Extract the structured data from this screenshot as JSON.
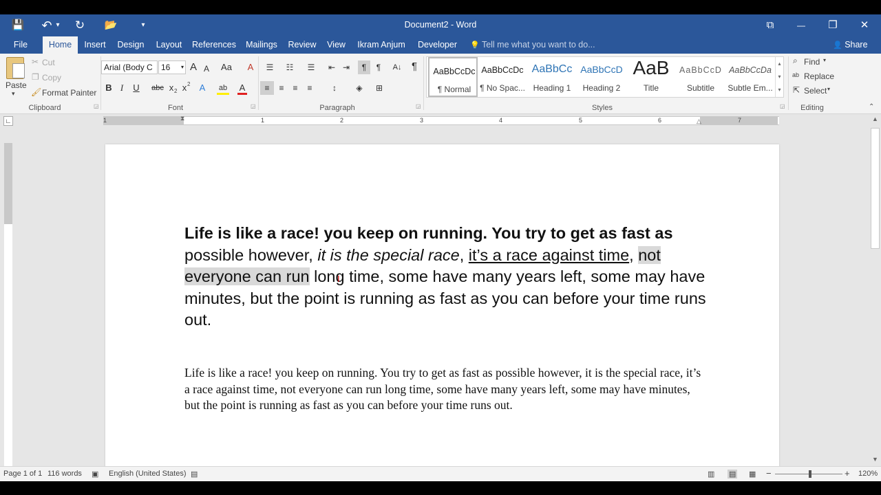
{
  "window": {
    "title": "Document2 - Word",
    "restore_icon": "⧉",
    "minimize_icon": "—",
    "maximize_icon": "❐",
    "close_icon": "✕"
  },
  "qat": {
    "save_icon": "💾",
    "undo_icon": "↶",
    "undo_dropdown_icon": "▾",
    "redo_icon": "↻",
    "open_icon": "📂",
    "customize_icon": "▾"
  },
  "tabs": [
    {
      "label": "File"
    },
    {
      "label": "Home"
    },
    {
      "label": "Insert"
    },
    {
      "label": "Design"
    },
    {
      "label": "Layout"
    },
    {
      "label": "References"
    },
    {
      "label": "Mailings"
    },
    {
      "label": "Review"
    },
    {
      "label": "View"
    },
    {
      "label": "Ikram Anjum"
    },
    {
      "label": "Developer"
    }
  ],
  "tell_me": {
    "icon": "💡",
    "placeholder": "Tell me what you want to do..."
  },
  "share": {
    "icon": "👤",
    "label": "Share"
  },
  "clipboard": {
    "paste": "Paste",
    "paste_arrow": "▾",
    "cut": "Cut",
    "copy": "Copy",
    "format_painter": "Format Painter",
    "group": "Clipboard"
  },
  "font": {
    "name": "Arial (Body C",
    "size": "16",
    "group": "Font",
    "grow": "A",
    "shrink": "A",
    "change_case": "Aa",
    "clear_format": "A",
    "bold": "B",
    "italic": "I",
    "underline": "U",
    "strike": "abc",
    "subscript": "x",
    "superscript": "x",
    "text_effects": "A",
    "highlight": "ab",
    "font_color": "A",
    "sub_mark": "2",
    "sup_mark": "2"
  },
  "paragraph": {
    "group": "Paragraph",
    "pilcrow": "¶",
    "sort": "A↓"
  },
  "styles": {
    "group": "Styles",
    "items": [
      {
        "preview": "AaBbCcDc",
        "name": "¶ Normal"
      },
      {
        "preview": "AaBbCcDc",
        "name": "¶ No Spac..."
      },
      {
        "preview": "AaBbCc",
        "name": "Heading 1"
      },
      {
        "preview": "AaBbCcD",
        "name": "Heading 2"
      },
      {
        "preview": "AaB",
        "name": "Title"
      },
      {
        "preview": "AaBbCcD",
        "name": "Subtitle"
      },
      {
        "preview": "AaBbCcDa",
        "name": "Subtle Em..."
      }
    ]
  },
  "editing": {
    "group": "Editing",
    "find": "Find",
    "replace": "Replace",
    "select": "Select"
  },
  "ruler": {
    "numbers": [
      "1",
      "1",
      "2",
      "3",
      "4",
      "5",
      "6",
      "7"
    ]
  },
  "document": {
    "p1": {
      "bold": "Life is like a race! you keep on running. You try to get as fast as",
      "plain1": " possible however, ",
      "italic": "it is the special race",
      "plain2": ", ",
      "underline": "it’s a race against time",
      "plain3": ", ",
      "highlight": "not everyone can run",
      "plain4": " long time, some have many years left, some may have minutes, but the point is running as fast as you can before your time runs out."
    },
    "p2": "Life is like a race! you keep on running. You try to get as fast as possible however, it is the special race, it’s a race against time, not everyone can run long time, some have many years left, some may have minutes, but the point is running as fast as you can before your time runs out."
  },
  "status": {
    "page": "Page 1 of 1",
    "words": "116 words",
    "language": "English (United States)",
    "zoom": "120%",
    "zoom_minus": "−",
    "zoom_plus": "+"
  }
}
